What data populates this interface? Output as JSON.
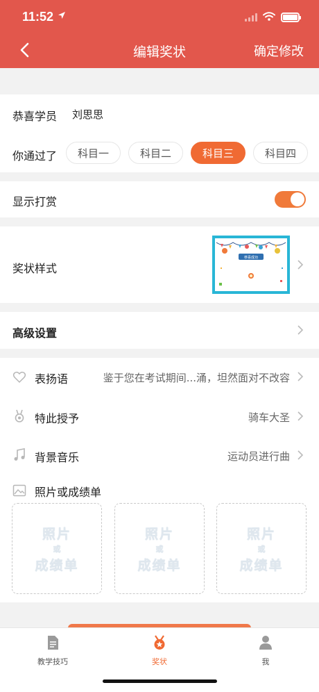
{
  "status": {
    "time": "11:52"
  },
  "nav": {
    "title": "编辑奖状",
    "confirm_label": "确定修改"
  },
  "student": {
    "label": "恭喜学员",
    "name": "刘思思"
  },
  "passed": {
    "label": "你通过了",
    "options": [
      "科目一",
      "科目二",
      "科目三",
      "科目四"
    ],
    "selected": "科目三"
  },
  "reward": {
    "label": "显示打赏",
    "enabled": true
  },
  "cert_style": {
    "label": "奖状样式",
    "banner_text": "恭喜成功"
  },
  "advanced": {
    "label": "高级设置"
  },
  "praise": {
    "label": "表扬语",
    "value": "鉴于您在考试期间...涌，坦然面对不改容"
  },
  "award": {
    "label": "特此授予",
    "value": "骑车大圣"
  },
  "music": {
    "label": "背景音乐",
    "value": "运动员进行曲"
  },
  "photos": {
    "label": "照片或成绩单",
    "placeholder_top": "照片",
    "placeholder_mid": "或",
    "placeholder_bottom": "成绩单"
  },
  "tabbar": {
    "items": [
      {
        "label": "教学技巧",
        "icon": "document-icon"
      },
      {
        "label": "奖状",
        "icon": "medal-icon"
      },
      {
        "label": "我",
        "icon": "person-icon"
      }
    ],
    "active": "奖状"
  },
  "colors": {
    "header": "#e2574c",
    "accent": "#f06a33",
    "cert_border": "#29b6d6"
  }
}
